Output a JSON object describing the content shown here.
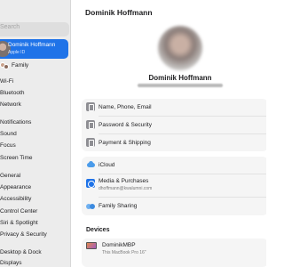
{
  "sidebar": {
    "search_placeholder": "Search",
    "account": {
      "name": "Dominik Hoffmann",
      "subtitle": "Apple ID"
    },
    "family_label": "Family",
    "items": [
      "Wi-Fi",
      "Bluetooth",
      "Network",
      "Notifications",
      "Sound",
      "Focus",
      "Screen Time",
      "General",
      "Appearance",
      "Accessibility",
      "Control Center",
      "Siri & Spotlight",
      "Privacy & Security",
      "Desktop & Dock",
      "Displays"
    ]
  },
  "main": {
    "title": "Dominik Hoffmann",
    "profile_name": "Dominik Hoffmann",
    "group1": [
      {
        "label": "Name, Phone, Email",
        "icon": "id-card-icon"
      },
      {
        "label": "Password & Security",
        "icon": "lock-icon"
      },
      {
        "label": "Payment & Shipping",
        "icon": "credit-card-icon"
      }
    ],
    "group2": [
      {
        "label": "iCloud",
        "icon": "icloud-icon"
      },
      {
        "label": "Media & Purchases",
        "subtitle": "dhoffmann@kwalumni.com",
        "icon": "app-store-icon"
      },
      {
        "label": "Family Sharing",
        "icon": "family-icon"
      }
    ],
    "devices_heading": "Devices",
    "device": {
      "name": "DominikMBP",
      "model": "This MacBook Pro 16\""
    }
  },
  "colors": {
    "accent": "#1f73e8",
    "sidebar_bg": "#ececec",
    "group_bg": "#f5f5f5"
  }
}
